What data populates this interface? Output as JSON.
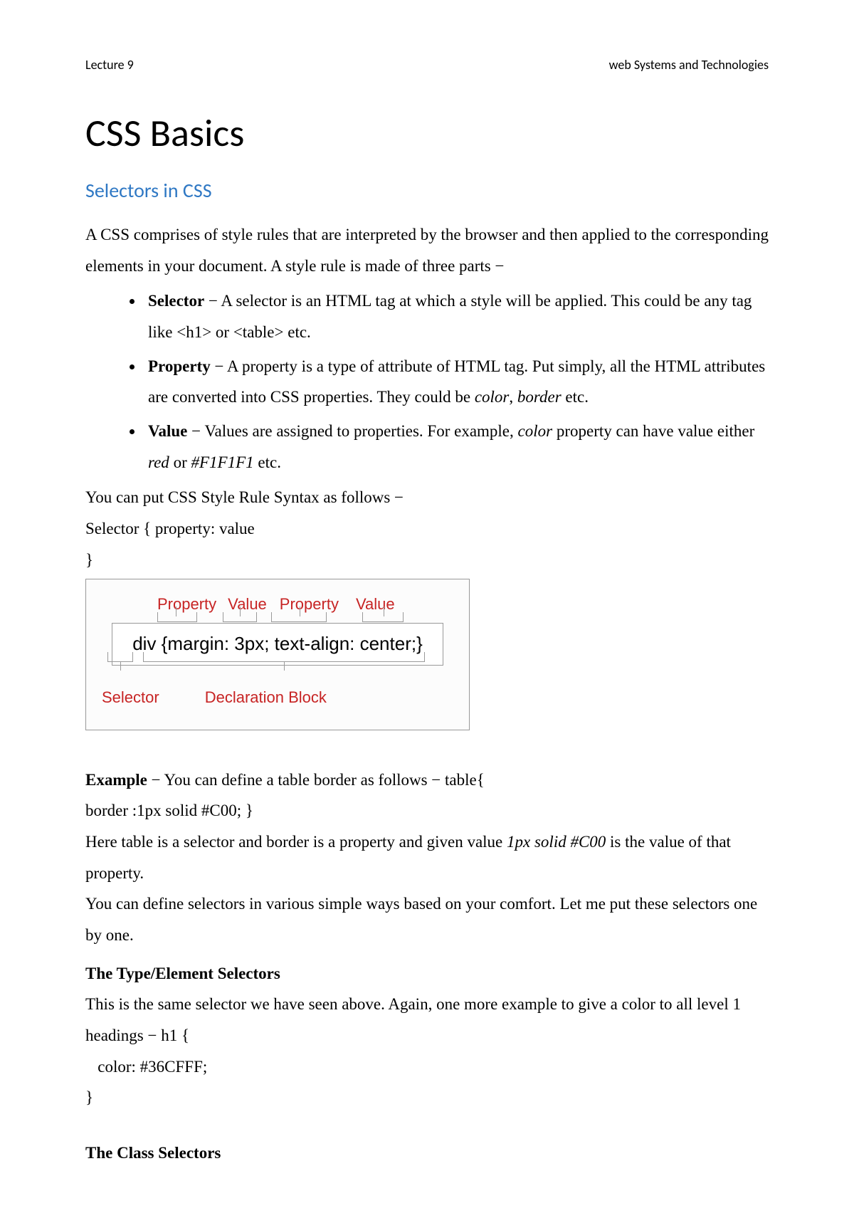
{
  "header": {
    "left": "Lecture 9",
    "right": "web Systems and Technologies"
  },
  "title": "CSS Basics",
  "subtitle": "Selectors in CSS",
  "intro": "A CSS comprises of style rules that are interpreted by the browser and then applied to the corresponding elements in your document. A style rule is made of three parts −",
  "bullets": {
    "b1": {
      "term": "Selector",
      "rest": " − A selector is an HTML tag at which a style will be applied. This could be any tag like <h1> or <table> etc."
    },
    "b2": {
      "term": "Property",
      "rest_a": " − A property is a type of attribute of HTML tag. Put simply, all the HTML attributes are converted into CSS properties. They could be ",
      "i1": "color",
      "comma": ", ",
      "i2": "border",
      "rest_b": " etc."
    },
    "b3": {
      "term": "Value",
      "rest_a": " − Values are assigned to properties. For example, ",
      "i1": "color",
      "mid": " property can have value either ",
      "i2": "red",
      "or": " or ",
      "i3": "#F1F1F1",
      "rest_b": " etc."
    }
  },
  "syntax_intro": "You can put CSS Style Rule Syntax as follows −",
  "syntax_line1": "Selector { property: value",
  "syntax_line2": "}",
  "diagram": {
    "labels": {
      "property1": "Property",
      "value1": "Value",
      "property2": "Property",
      "value2": "Value",
      "selector": "Selector",
      "declblock": "Declaration Block"
    },
    "code": "div {margin: 3px; text-align: center;}"
  },
  "example": {
    "term": "Example",
    "rest": " − You can define a table border as follows − table{",
    "line2": "border :1px solid #C00; }",
    "explain_a": "Here table is a selector and border is a property and given value ",
    "explain_i": "1px solid #C00",
    "explain_b": " is the value of that property.",
    "explain2": "You can define selectors in various simple ways based on your comfort. Let me put these selectors one by one."
  },
  "typeSel": {
    "heading": "The Type/Element Selectors",
    "text": "This is the same selector we have seen above. Again, one more example to give a color to all level 1 headings − h1 {",
    "code1": "   color: #36CFFF;",
    "code2": "}"
  },
  "classSel": {
    "heading": "The Class Selectors"
  }
}
